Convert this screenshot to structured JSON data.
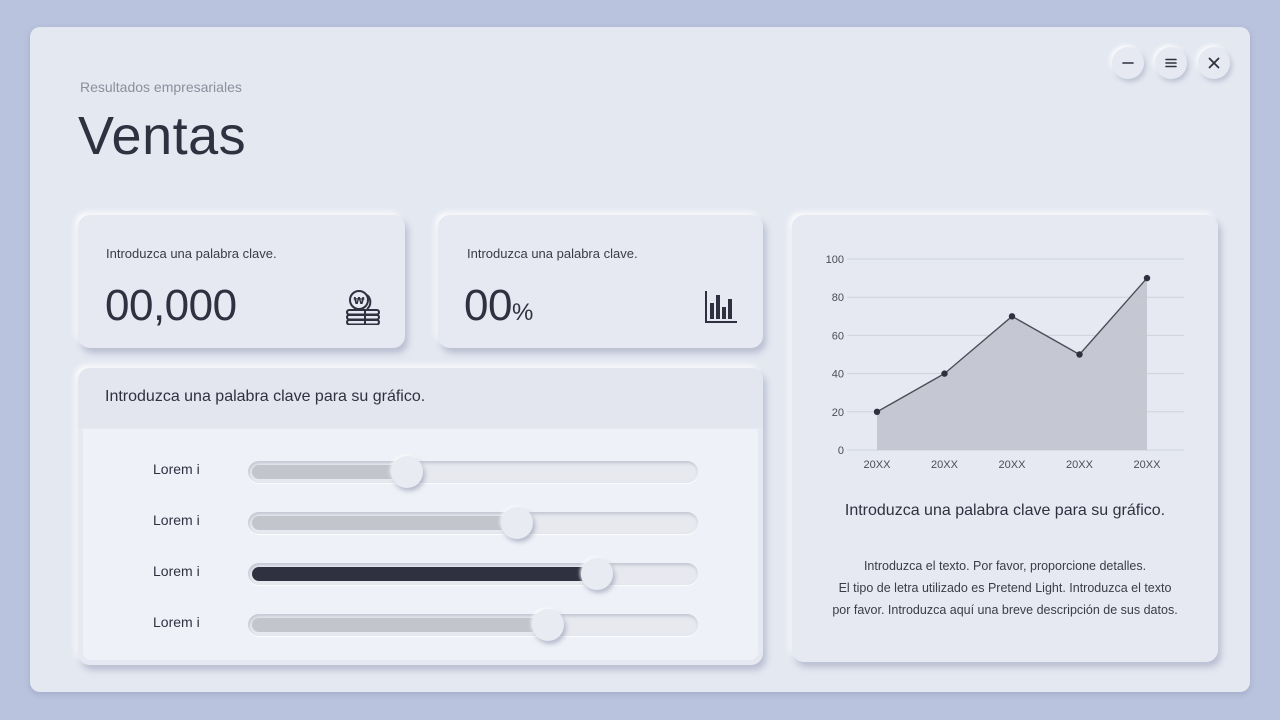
{
  "header": {
    "subtitle": "Resultados empresariales",
    "title": "Ventas"
  },
  "window_controls": {
    "minimize_icon": "minus-icon",
    "menu_icon": "hamburger-icon",
    "close_icon": "close-icon"
  },
  "kpis": [
    {
      "label": "Introduzca una palabra clave.",
      "value": "00,000",
      "unit": "",
      "icon": "coins-icon"
    },
    {
      "label": "Introduzca una palabra clave.",
      "value": "00",
      "unit": "%",
      "icon": "bar-chart-icon"
    }
  ],
  "sliders_panel": {
    "title": "Introduzca una palabra clave para su gráfico.",
    "items": [
      {
        "label": "Lorem i",
        "level": 0.35,
        "style": "light"
      },
      {
        "label": "Lorem i",
        "level": 0.6,
        "style": "light"
      },
      {
        "label": "Lorem i",
        "level": 0.78,
        "style": "dark"
      },
      {
        "label": "Lorem i",
        "level": 0.67,
        "style": "light"
      }
    ]
  },
  "chart_panel": {
    "caption": "Introduzca una palabra clave para su gráfico.",
    "description": [
      "Introduzca el texto. Por favor, proporcione detalles.",
      "El tipo de letra utilizado es Pretend Light. Introduzca el texto",
      "por favor. Introduzca aquí una breve descripción de sus datos."
    ]
  },
  "colors": {
    "accent_dark": "#2f3140",
    "area_fill": "#c3c5d0",
    "background": "#b9c3dd"
  },
  "chart_data": {
    "type": "area",
    "categories": [
      "20XX",
      "20XX",
      "20XX",
      "20XX",
      "20XX"
    ],
    "values": [
      20,
      40,
      70,
      50,
      90
    ],
    "ylim": [
      0,
      100
    ],
    "yticks": [
      0,
      20,
      40,
      60,
      80,
      100
    ],
    "grid": true,
    "title": "",
    "xlabel": "",
    "ylabel": ""
  }
}
